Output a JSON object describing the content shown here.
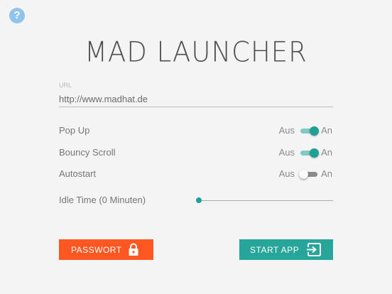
{
  "app": {
    "title": "MAD LAUNCHER"
  },
  "help": {
    "label": "?"
  },
  "url": {
    "label": "URL",
    "value": "http://www.madhat.de"
  },
  "settings": [
    {
      "label": "Pop Up",
      "off": "Aus",
      "on": "An",
      "enabled": true
    },
    {
      "label": "Bouncy Scroll",
      "off": "Aus",
      "on": "An",
      "enabled": true
    },
    {
      "label": "Autostart",
      "off": "Aus",
      "on": "An",
      "enabled": false
    }
  ],
  "idle": {
    "label": "Idle Time (0 Minuten)",
    "value": 0
  },
  "buttons": {
    "password": "PASSWORT",
    "start": "START APP"
  },
  "colors": {
    "accent": "#26a69a",
    "password": "#ff5722",
    "help": "#90c4ec"
  },
  "icons": {
    "help": "question-icon",
    "password": "lock-icon",
    "start": "exit-to-app-icon"
  }
}
